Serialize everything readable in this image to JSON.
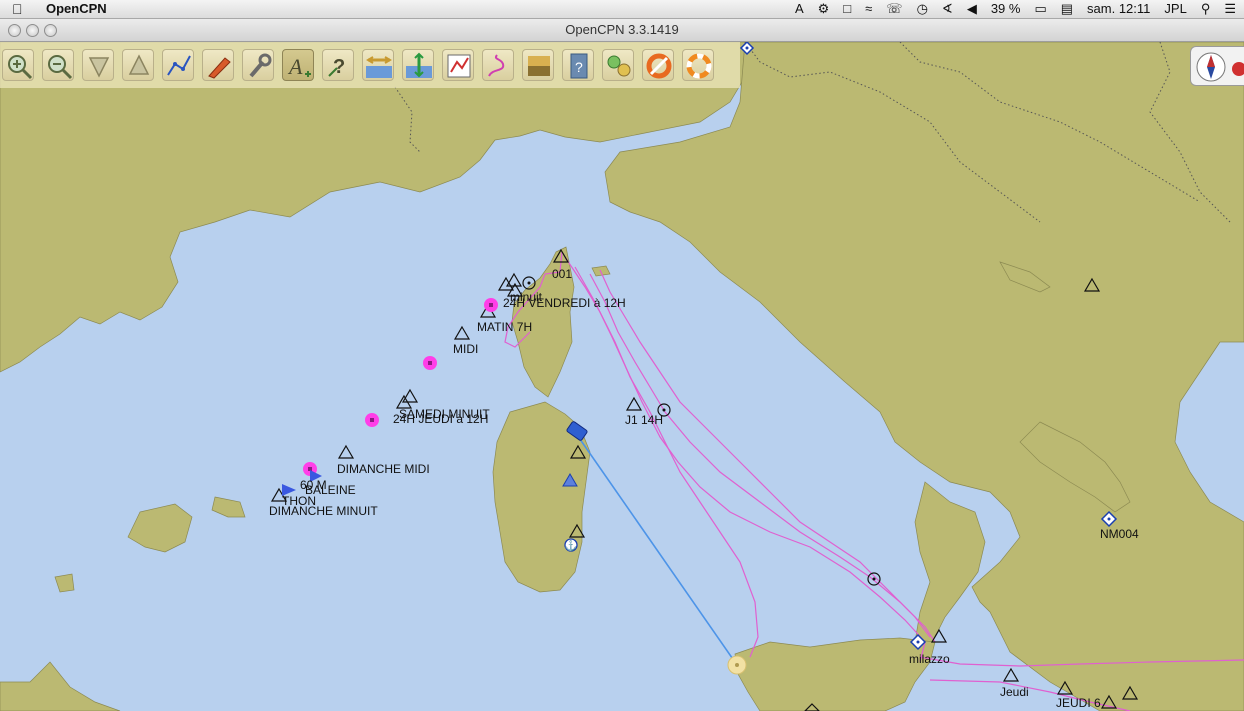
{
  "menubar": {
    "app_name": "OpenCPN",
    "battery": "39 %",
    "clock": "sam. 12:11",
    "user": "JPL"
  },
  "window": {
    "title": "OpenCPN 3.3.1419"
  },
  "toolbar": {
    "tools": [
      {
        "name": "zoom-in-button",
        "icon": "zoom-in-icon"
      },
      {
        "name": "zoom-out-button",
        "icon": "zoom-out-icon"
      },
      {
        "name": "scale-in-button",
        "icon": "scale-in-icon"
      },
      {
        "name": "scale-out-button",
        "icon": "scale-out-icon"
      },
      {
        "name": "create-route-button",
        "icon": "route-icon"
      },
      {
        "name": "auto-follow-button",
        "icon": "boat-icon"
      },
      {
        "name": "settings-button",
        "icon": "wrench-icon"
      },
      {
        "name": "text-button",
        "icon": "text-icon"
      },
      {
        "name": "current-tide-button",
        "icon": "query-icon"
      },
      {
        "name": "tides-button",
        "icon": "tide-icon"
      },
      {
        "name": "currents-button",
        "icon": "current-icon"
      },
      {
        "name": "grib-button",
        "icon": "chart-icon"
      },
      {
        "name": "track-button",
        "icon": "track-icon"
      },
      {
        "name": "color-scheme-button",
        "icon": "colour-icon"
      },
      {
        "name": "help-button",
        "icon": "help-icon"
      },
      {
        "name": "plugin-button",
        "icon": "plugin-icon"
      },
      {
        "name": "mob-button",
        "icon": "lifebuoy-icon"
      },
      {
        "name": "ais-button",
        "icon": "ring-icon"
      }
    ]
  },
  "map": {
    "waypoint_labels": {
      "w001": "001",
      "minuit": "minuit",
      "vendredi": "24H VENDREDI à 12H",
      "matin": "MATIN 7H",
      "midi": "MIDI",
      "samedi": "SAMEDI MINUIT",
      "jeudi": "24H JEUDI à 12H",
      "dim_midi": "DIMANCHE MIDI",
      "m60": "60 M",
      "baleine": "BALEINE",
      "thon": "THON",
      "dim_minuit": "DIMANCHE MINUIT",
      "j1": "J1 14H",
      "nm004": "NM004",
      "milazzo": "milazzo",
      "jeudi_lc": "Jeudi",
      "jeudi6": "JEUDI 6"
    },
    "colors": {
      "water": "#b8d0ee",
      "land": "#bbb972",
      "track": "#e060d0",
      "route": "#4d94e8",
      "waypoint_magenta": "#ff3ee8"
    }
  }
}
